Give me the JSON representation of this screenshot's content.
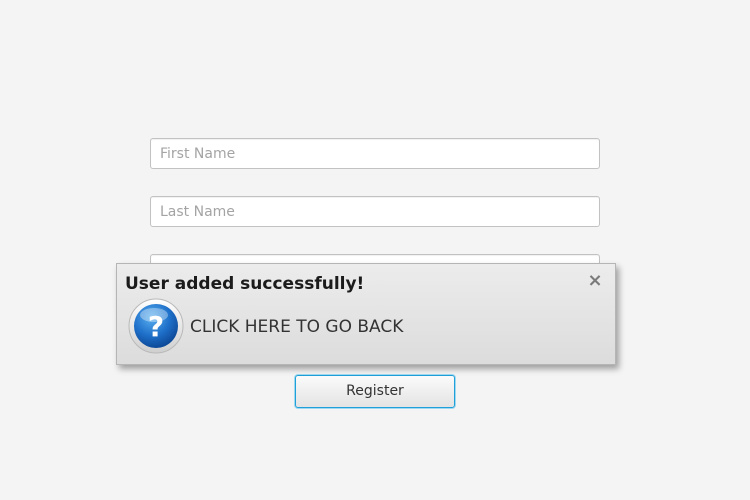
{
  "form": {
    "first_name_placeholder": "First Name",
    "last_name_placeholder": "Last Name",
    "first_name_value": "",
    "last_name_value": "",
    "register_label": "Register"
  },
  "popup": {
    "title": "User added successfully!",
    "close_symbol": "×",
    "message": "CLICK HERE TO GO BACK",
    "icon": "question-icon"
  },
  "colors": {
    "background": "#f4f4f4",
    "accent_focus": "#1fa0d8",
    "icon_blue": "#1565c0"
  }
}
